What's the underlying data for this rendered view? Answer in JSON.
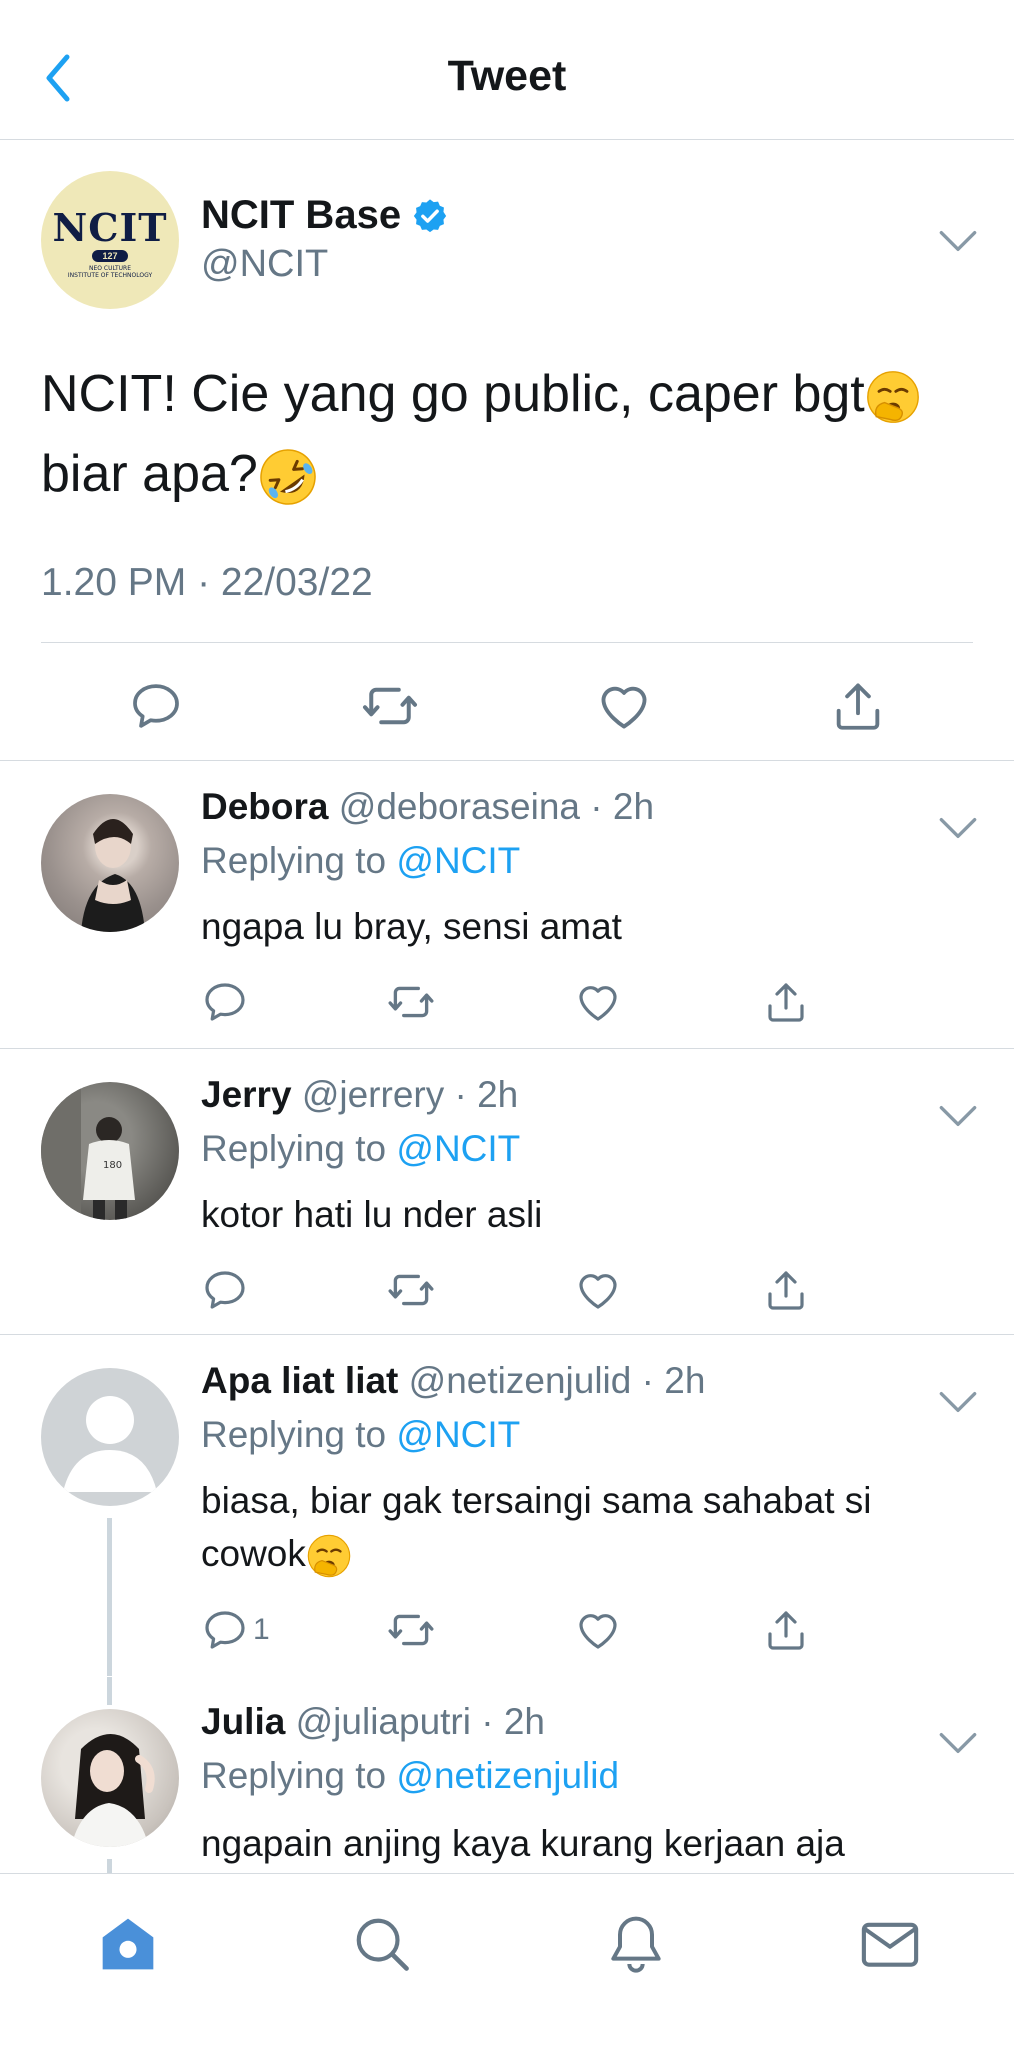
{
  "header": {
    "title": "Tweet"
  },
  "main_tweet": {
    "author_name": "NCIT Base",
    "author_handle": "@NCIT",
    "avatar_logo": {
      "big": "NCIT",
      "pill": "127",
      "line1": "NEO CULTURE",
      "line2": "INSTITUTE OF TECHNOLOGY"
    },
    "text_line1": "NCIT! Cie yang go public, caper bgt",
    "text_line2": "biar apa?",
    "timestamp": "1.20 PM · 22/03/22"
  },
  "replies": [
    {
      "name": "Debora",
      "meta": "@deboraseina · 2h",
      "replying_prefix": "Replying to ",
      "replying_to": "@NCIT",
      "text": "ngapa lu bray, sensi amat",
      "reply_count": ""
    },
    {
      "name": "Jerry",
      "meta": "@jerrery · 2h",
      "replying_prefix": "Replying to ",
      "replying_to": "@NCIT",
      "text": "kotor hati lu nder asli",
      "reply_count": ""
    },
    {
      "name": "Apa liat liat",
      "meta": "@netizenjulid · 2h",
      "replying_prefix": "Replying to ",
      "replying_to": "@NCIT",
      "text_line1": "biasa, biar gak tersaingi sama sahabat si",
      "text_line2": "cowok",
      "reply_count": "1"
    },
    {
      "name": "Julia",
      "meta": "@juliaputri · 2h",
      "replying_prefix": "Replying to ",
      "replying_to": "@netizenjulid",
      "text": "ngapain anjing kaya kurang kerjaan aja",
      "reply_count": ""
    }
  ],
  "icons": {
    "back": "chevron-left-icon",
    "caret": "chevron-down-icon",
    "verified": "verified-badge-icon",
    "reply": "reply-bubble-icon",
    "retweet": "retweet-icon",
    "like": "heart-icon",
    "share": "share-icon",
    "tabs": [
      "home-icon",
      "search-icon",
      "notifications-bell-icon",
      "messages-envelope-icon"
    ]
  },
  "colors": {
    "accent": "#1da1f2",
    "text_primary": "#14171a",
    "text_secondary": "#657786",
    "divider": "#d6dbe0",
    "home_tab_active": "#4a90d9"
  }
}
